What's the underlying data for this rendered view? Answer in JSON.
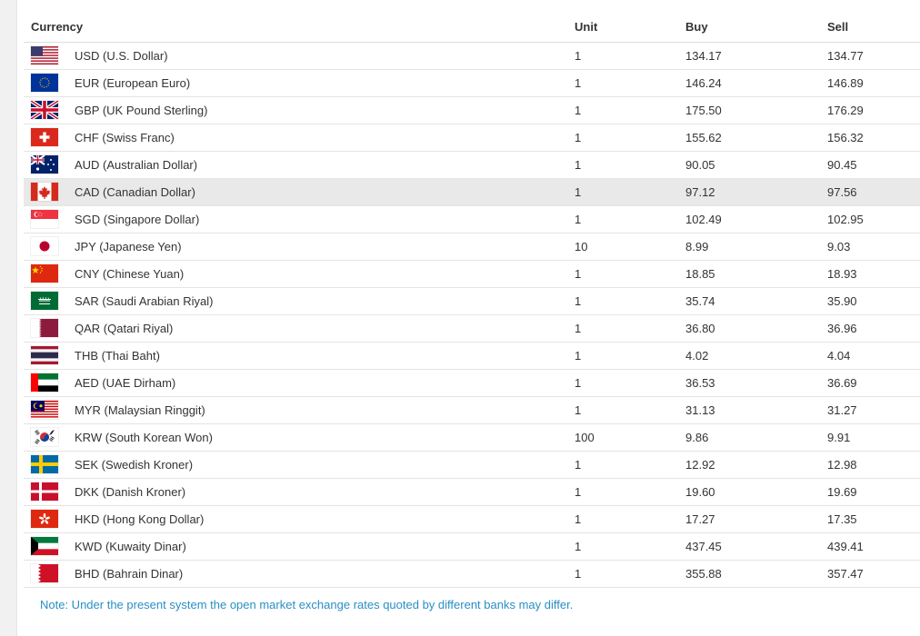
{
  "table": {
    "headers": {
      "currency": "Currency",
      "unit": "Unit",
      "buy": "Buy",
      "sell": "Sell"
    },
    "rows": [
      {
        "flag": "usa-flag-icon",
        "currency": "USD (U.S. Dollar)",
        "unit": "1",
        "buy": "134.17",
        "sell": "134.77"
      },
      {
        "flag": "eu-flag-icon",
        "currency": "EUR (European Euro)",
        "unit": "1",
        "buy": "146.24",
        "sell": "146.89"
      },
      {
        "flag": "uk-flag-icon",
        "currency": "GBP (UK Pound Sterling)",
        "unit": "1",
        "buy": "175.50",
        "sell": "176.29"
      },
      {
        "flag": "switzerland-flag-icon",
        "currency": "CHF (Swiss Franc)",
        "unit": "1",
        "buy": "155.62",
        "sell": "156.32"
      },
      {
        "flag": "australia-flag-icon",
        "currency": "AUD (Australian Dollar)",
        "unit": "1",
        "buy": "90.05",
        "sell": "90.45"
      },
      {
        "flag": "canada-flag-icon",
        "currency": "CAD (Canadian Dollar)",
        "unit": "1",
        "buy": "97.12",
        "sell": "97.56"
      },
      {
        "flag": "singapore-flag-icon",
        "currency": "SGD (Singapore Dollar)",
        "unit": "1",
        "buy": "102.49",
        "sell": "102.95"
      },
      {
        "flag": "japan-flag-icon",
        "currency": "JPY (Japanese Yen)",
        "unit": "10",
        "buy": "8.99",
        "sell": "9.03"
      },
      {
        "flag": "china-flag-icon",
        "currency": "CNY (Chinese Yuan)",
        "unit": "1",
        "buy": "18.85",
        "sell": "18.93"
      },
      {
        "flag": "saudi-arabia-flag-icon",
        "currency": "SAR (Saudi Arabian Riyal)",
        "unit": "1",
        "buy": "35.74",
        "sell": "35.90"
      },
      {
        "flag": "qatar-flag-icon",
        "currency": "QAR (Qatari Riyal)",
        "unit": "1",
        "buy": "36.80",
        "sell": "36.96"
      },
      {
        "flag": "thailand-flag-icon",
        "currency": "THB (Thai Baht)",
        "unit": "1",
        "buy": "4.02",
        "sell": "4.04"
      },
      {
        "flag": "uae-flag-icon",
        "currency": "AED (UAE Dirham)",
        "unit": "1",
        "buy": "36.53",
        "sell": "36.69"
      },
      {
        "flag": "malaysia-flag-icon",
        "currency": "MYR (Malaysian Ringgit)",
        "unit": "1",
        "buy": "31.13",
        "sell": "31.27"
      },
      {
        "flag": "south-korea-flag-icon",
        "currency": "KRW (South Korean Won)",
        "unit": "100",
        "buy": "9.86",
        "sell": "9.91"
      },
      {
        "flag": "sweden-flag-icon",
        "currency": "SEK (Swedish Kroner)",
        "unit": "1",
        "buy": "12.92",
        "sell": "12.98"
      },
      {
        "flag": "denmark-flag-icon",
        "currency": "DKK (Danish Kroner)",
        "unit": "1",
        "buy": "19.60",
        "sell": "19.69"
      },
      {
        "flag": "hong-kong-flag-icon",
        "currency": "HKD (Hong Kong Dollar)",
        "unit": "1",
        "buy": "17.27",
        "sell": "17.35"
      },
      {
        "flag": "kuwait-flag-icon",
        "currency": "KWD (Kuwaity Dinar)",
        "unit": "1",
        "buy": "437.45",
        "sell": "439.41"
      },
      {
        "flag": "bahrain-flag-icon",
        "currency": "BHD (Bahrain Dinar)",
        "unit": "1",
        "buy": "355.88",
        "sell": "357.47"
      }
    ],
    "highlighted_row": 5
  },
  "note": "Note: Under the present system the open market exchange rates quoted by different banks may differ.",
  "colors": {
    "note": "#2a8fc6",
    "highlight_row": "#e9e9e9",
    "border": "#e4e4e4"
  }
}
